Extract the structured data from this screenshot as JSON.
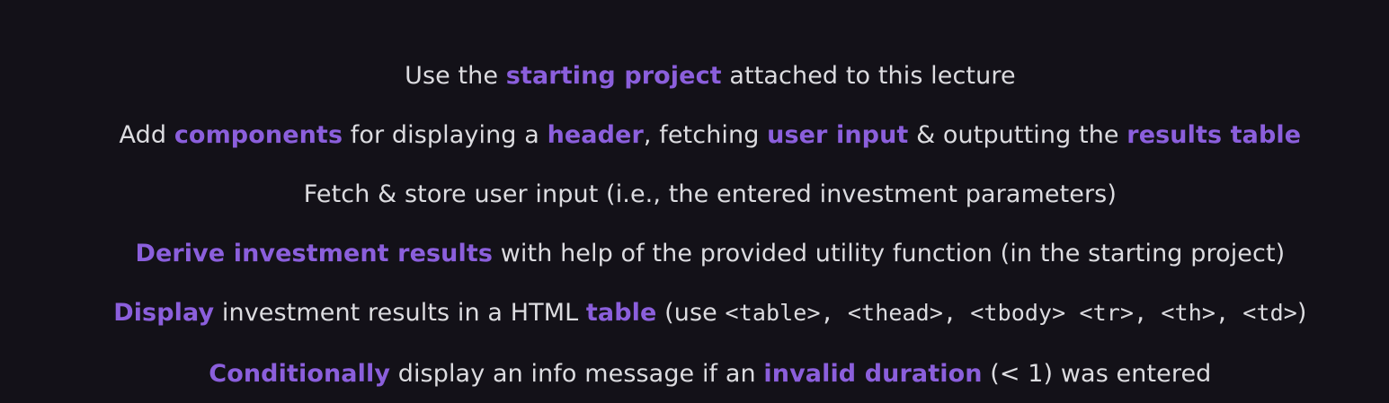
{
  "colors": {
    "background": "#131118",
    "text": "#dcdce0",
    "highlight": "#8b5fdc"
  },
  "lines": [
    {
      "segments": [
        {
          "text": "Use the ",
          "style": "normal"
        },
        {
          "text": "starting project",
          "style": "highlight"
        },
        {
          "text": " attached to this lecture",
          "style": "normal"
        }
      ]
    },
    {
      "segments": [
        {
          "text": "Add ",
          "style": "normal"
        },
        {
          "text": "components",
          "style": "highlight"
        },
        {
          "text": " for displaying a ",
          "style": "normal"
        },
        {
          "text": "header",
          "style": "highlight"
        },
        {
          "text": ", fetching ",
          "style": "normal"
        },
        {
          "text": "user input",
          "style": "highlight"
        },
        {
          "text": " & outputting the ",
          "style": "normal"
        },
        {
          "text": "results table",
          "style": "highlight"
        }
      ]
    },
    {
      "segments": [
        {
          "text": "Fetch & store user input (i.e., the entered investment parameters)",
          "style": "normal"
        }
      ]
    },
    {
      "segments": [
        {
          "text": "Derive investment results",
          "style": "highlight"
        },
        {
          "text": " with help of the provided utility function (in the starting project)",
          "style": "normal"
        }
      ]
    },
    {
      "segments": [
        {
          "text": "Display",
          "style": "highlight"
        },
        {
          "text": " investment results in a HTML ",
          "style": "normal"
        },
        {
          "text": "table",
          "style": "highlight"
        },
        {
          "text": " (use ",
          "style": "normal"
        },
        {
          "text": "<table>, <thead>, <tbody> <tr>, <th>, <td>",
          "style": "code"
        },
        {
          "text": ")",
          "style": "normal"
        }
      ]
    },
    {
      "segments": [
        {
          "text": "Conditionally",
          "style": "highlight"
        },
        {
          "text": " display an info message if an ",
          "style": "normal"
        },
        {
          "text": "invalid duration",
          "style": "highlight"
        },
        {
          "text": " (< 1) was entered",
          "style": "normal"
        }
      ]
    }
  ]
}
